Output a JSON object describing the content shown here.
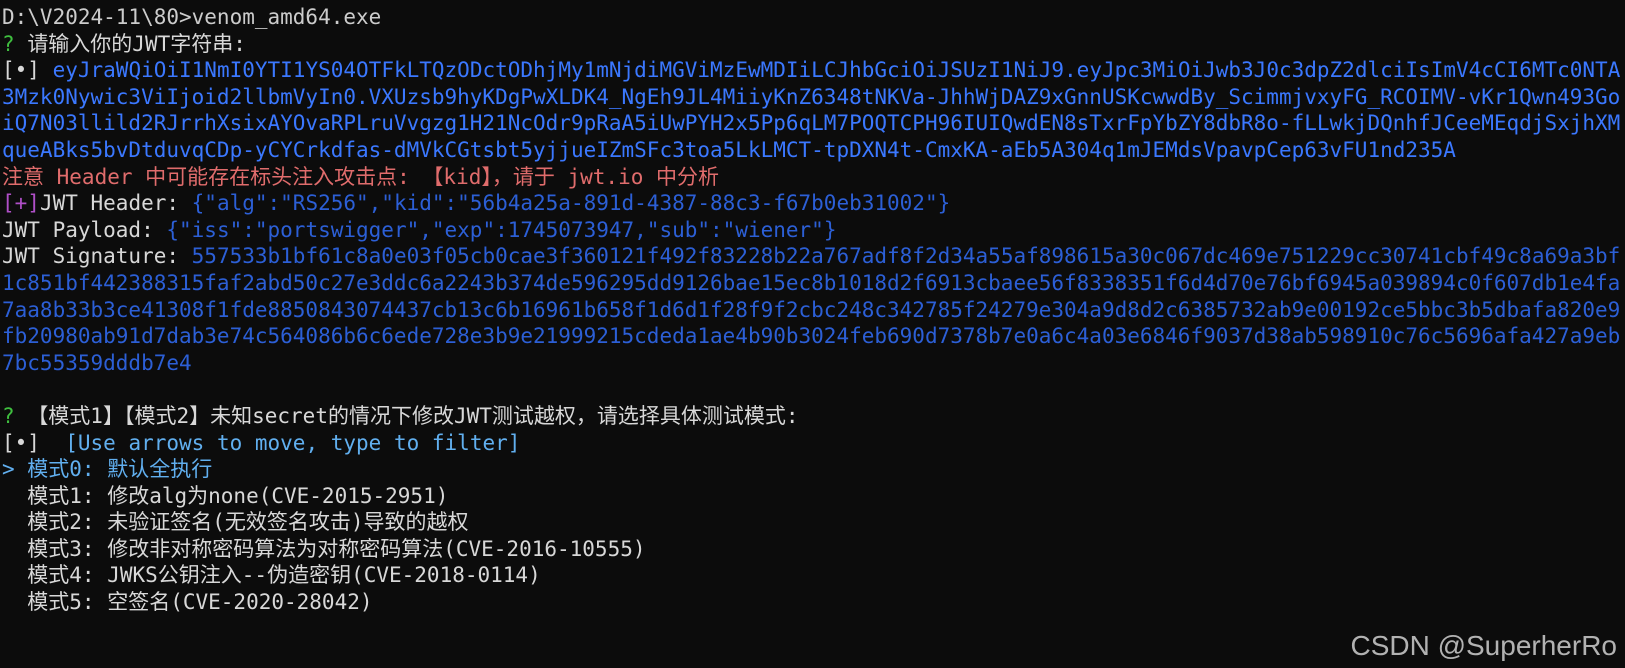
{
  "terminal": {
    "command_line": "D:\\V2024-11\\80>venom_amd64.exe",
    "prompt_question_mark": "?",
    "input_prompt": "请输入你的JWT字符串:",
    "input_marker": "[•]",
    "jwt_token": "eyJraWQiOiI1NmI0YTI1YS04OTFkLTQzODctODhjMy1mNjdiMGViMzEwMDIiLCJhbGciOiJSUzI1NiJ9.eyJpc3MiOiJwb3J0c3dpZ2dlciIsImV4cCI6MTc0NTA3Mzk0Nywic3ViIjoid2llbmVyIn0.VXUzsb9hyKDgPwXLDK4_NgEh9JL4MiiyKnZ6348tNKVa-JhhWjDAZ9xGnnUSKcwwdBy_ScimmjvxyFG_RCOIMV-vKr1Qwn493GoiQ7N03llild2RJrrhXsixAYOvaRPLruVvgzg1H21NcOdr9pRaA5iUwPYH2x5Pp6qLM7POQTCPH96IUIQwdEN8sTxrFpYbZY8dbR8o-fLLwkjDQnhfJCeeMEqdjSxjhXMqueABks5bvDtduvqCDp-yCYCrkdfas-dMVkCGtsbt5yjjueIZmSFc3toa5LkLMCT-tpDXN4t-CmxKA-aEb5A304q1mJEMdsVpavpCep63vFU1nd235A",
    "warning": "注意 Header 中可能存在标头注入攻击点: 【kid】，请于 jwt.io 中分析",
    "header_marker": "[+]",
    "header_label": "JWT Header: ",
    "header_value": "{\"alg\":\"RS256\",\"kid\":\"56b4a25a-891d-4387-88c3-f67b0eb31002\"}",
    "payload_label": "JWT Payload: ",
    "payload_value": "{\"iss\":\"portswigger\",\"exp\":1745073947,\"sub\":\"wiener\"}",
    "signature_label": "JWT Signature: ",
    "signature_value": "557533b1bf61c8a0e03f05cb0cae3f360121f492f83228b22a767adf8f2d34a55af898615a30c067dc469e751229cc30741cbf49c8a69a3bf1c851bf442388315faf2abd50c27e3ddc6a2243b374de596295dd9126bae15ec8b1018d2f6913cbaee56f8338351f6d4d70e76bf6945a039894c0f607db1e4fa7aa8b33b3ce41308f1fde8850843074437cb13c6b16961b658f1d6d1f28f9f2cbc248c342785f24279e304a9d8d2c6385732ab9e00192ce5bbc3b5dbafa820e9fb20980ab91d7dab3e74c564086b6c6ede728e3b9e21999215cdeda1ae4b90b3024feb690d7378b7e0a6c4a03e6846f9037d38ab598910c76c5696afa427a9eb7bc55359dddb7e4",
    "mode_question": "【模式1】【模式2】未知secret的情况下修改JWT测试越权，请选择具体测试模式:",
    "select_marker": "[•]",
    "select_hint": "[Use arrows to move, type to filter]",
    "options": [
      {
        "label": "> 模式0: 默认全执行",
        "selected": true
      },
      {
        "label": "  模式1: 修改alg为none(CVE-2015-2951)",
        "selected": false
      },
      {
        "label": "  模式2: 未验证签名(无效签名攻击)导致的越权",
        "selected": false
      },
      {
        "label": "  模式3: 修改非对称密码算法为对称密码算法(CVE-2016-10555)",
        "selected": false
      },
      {
        "label": "  模式4: JWKS公钥注入--伪造密钥(CVE-2018-0114)",
        "selected": false
      },
      {
        "label": "  模式5: 空签名(CVE-2020-28042)",
        "selected": false
      }
    ]
  },
  "watermark": "CSDN @SuperherRo",
  "colors": {
    "background": "#0c0c0c",
    "text": "#cccccc",
    "prompt_green": "#3fbf3f",
    "token_blue": "#3b78ff",
    "warning_red": "#e06c6c",
    "marker_magenta": "#b04fc8",
    "selected_cyan": "#61afef"
  }
}
